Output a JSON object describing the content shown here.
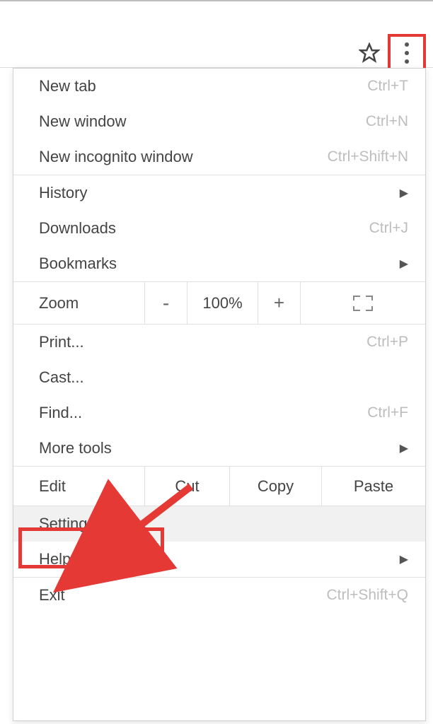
{
  "toolbar": {
    "bookmark_icon": "star-icon",
    "menu_icon": "more-vert-icon"
  },
  "menu": {
    "section1": [
      {
        "label": "New tab",
        "shortcut": "Ctrl+T"
      },
      {
        "label": "New window",
        "shortcut": "Ctrl+N"
      },
      {
        "label": "New incognito window",
        "shortcut": "Ctrl+Shift+N"
      }
    ],
    "section2": [
      {
        "label": "History",
        "submenu": true
      },
      {
        "label": "Downloads",
        "shortcut": "Ctrl+J"
      },
      {
        "label": "Bookmarks",
        "submenu": true
      }
    ],
    "zoom": {
      "label": "Zoom",
      "minus": "-",
      "percent": "100%",
      "plus": "+"
    },
    "section3": [
      {
        "label": "Print...",
        "shortcut": "Ctrl+P"
      },
      {
        "label": "Cast..."
      },
      {
        "label": "Find...",
        "shortcut": "Ctrl+F"
      },
      {
        "label": "More tools",
        "submenu": true
      }
    ],
    "edit": {
      "label": "Edit",
      "cut": "Cut",
      "copy": "Copy",
      "paste": "Paste"
    },
    "section4": [
      {
        "label": "Settings"
      },
      {
        "label": "Help",
        "submenu": true
      }
    ],
    "section5": [
      {
        "label": "Exit",
        "shortcut": "Ctrl+Shift+Q"
      }
    ]
  }
}
